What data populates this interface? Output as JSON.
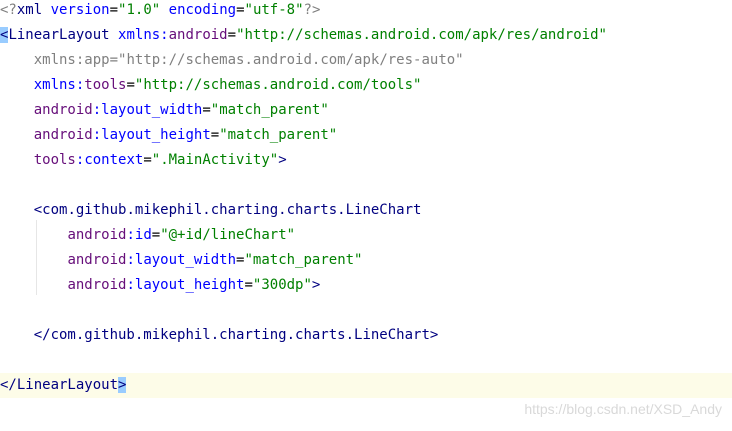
{
  "code": {
    "xml_decl": {
      "open": "<?",
      "name": "xml",
      "version_attr": "version",
      "version_val": "\"1.0\"",
      "encoding_attr": "encoding",
      "encoding_val": "\"utf-8\"",
      "close": "?>"
    },
    "root_open": {
      "lt": "<",
      "tag": "LinearLayout",
      "ns_prefix": "xmlns:",
      "ns_name": "android",
      "eq": "=",
      "ns_value": "\"http://schemas.android.com/apk/res/android\""
    },
    "ns_app": {
      "prefix": "xmlns:",
      "name": "app",
      "eq": "=",
      "value": "\"http://schemas.android.com/apk/res-auto\""
    },
    "ns_tools": {
      "prefix": "xmlns:",
      "name": "tools",
      "eq": "=",
      "value": "\"http://schemas.android.com/tools\""
    },
    "root_width": {
      "ns": "android",
      "colon": ":",
      "attr": "layout_width",
      "eq": "=",
      "value": "\"match_parent\""
    },
    "root_height": {
      "ns": "android",
      "colon": ":",
      "attr": "layout_height",
      "eq": "=",
      "value": "\"match_parent\""
    },
    "root_context": {
      "ns": "tools",
      "colon": ":",
      "attr": "context",
      "eq": "=",
      "value": "\".MainActivity\"",
      "gt": ">"
    },
    "chart_open": {
      "lt": "<",
      "tag": "com.github.mikephil.charting.charts.LineChart"
    },
    "chart_id": {
      "ns": "android",
      "colon": ":",
      "attr": "id",
      "eq": "=",
      "value": "\"@+id/lineChart\""
    },
    "chart_width": {
      "ns": "android",
      "colon": ":",
      "attr": "layout_width",
      "eq": "=",
      "value": "\"match_parent\""
    },
    "chart_height": {
      "ns": "android",
      "colon": ":",
      "attr": "layout_height",
      "eq": "=",
      "value": "\"300dp\"",
      "gt": ">"
    },
    "chart_close": {
      "lt": "</",
      "tag": "com.github.mikephil.charting.charts.LineChart",
      "gt": ">"
    },
    "root_close": {
      "lt": "</",
      "tag": "LinearLayout",
      "gt": ">"
    }
  },
  "watermark": "https://blog.csdn.net/XSD_Andy",
  "colors": {
    "tag": "#000080",
    "namespace": "#660e7a",
    "attribute": "#0000ff",
    "string": "#008000",
    "muted": "#808080",
    "current_line": "#fdfce8",
    "bracket_highlight": "#99ccff"
  }
}
